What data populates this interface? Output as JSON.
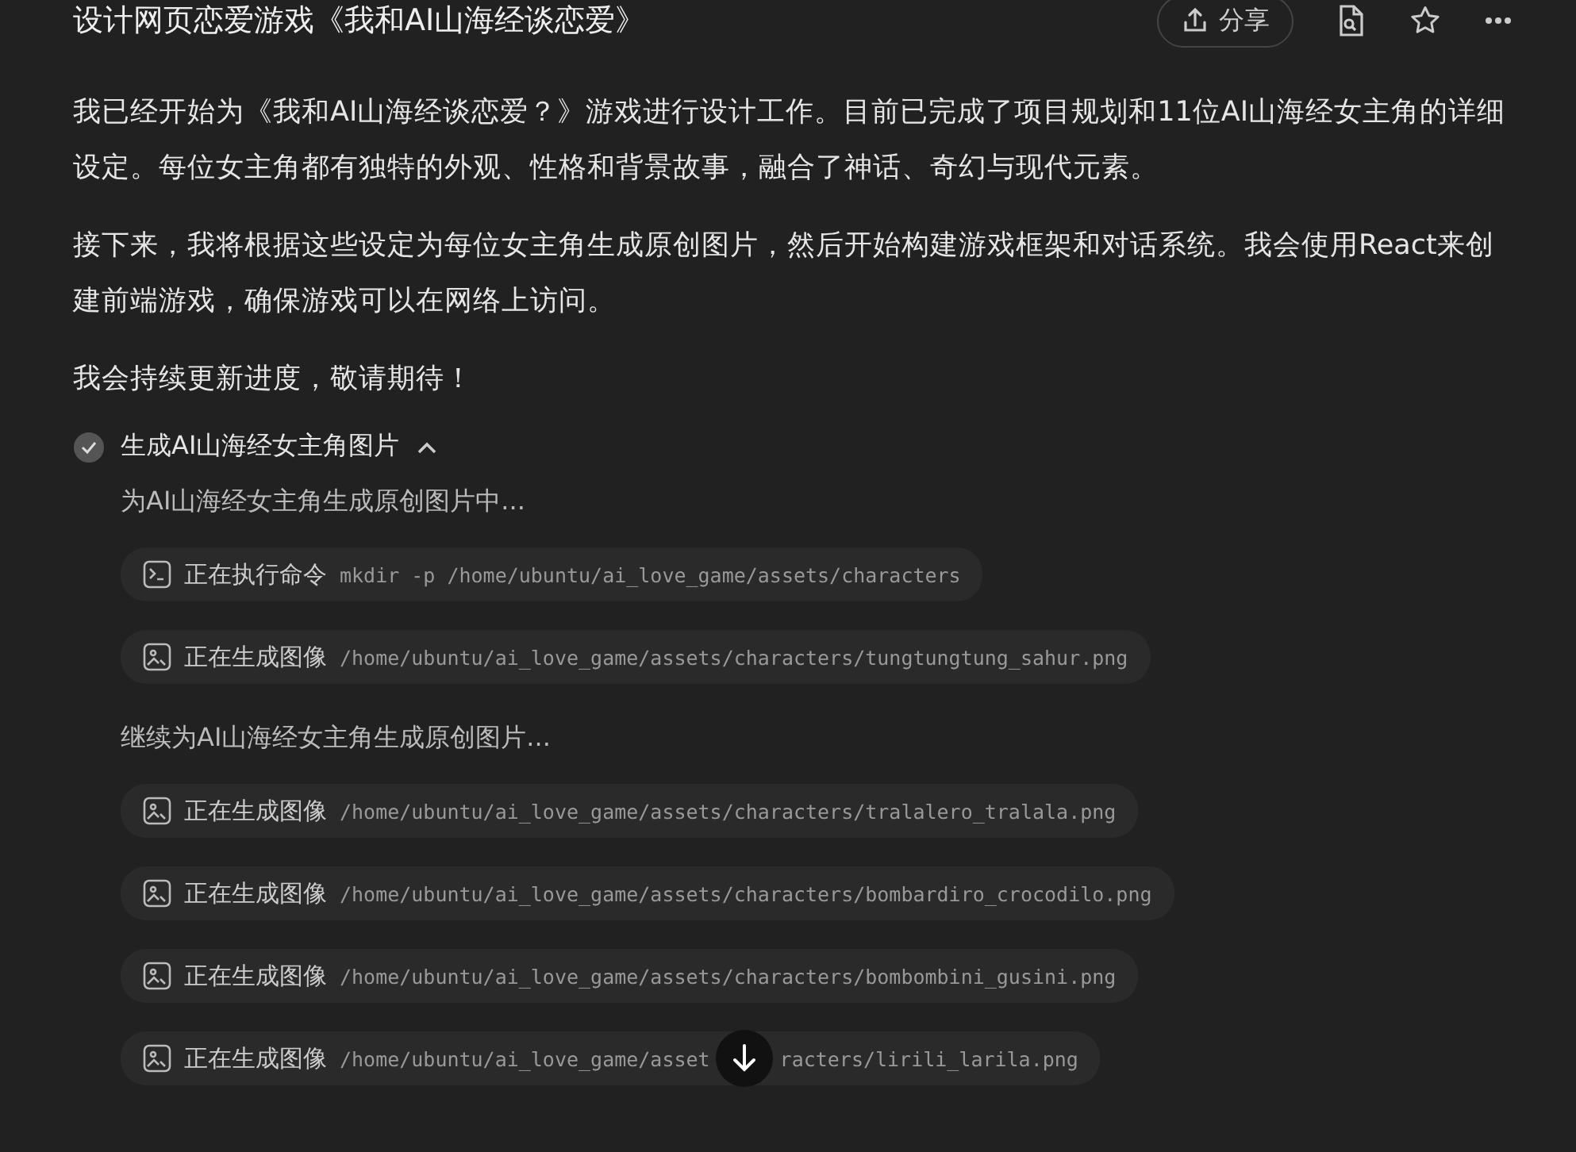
{
  "header": {
    "title": "设计网页恋爱游戏《我和AI山海经谈恋爱》",
    "share": "分享"
  },
  "paragraphs": [
    "我已经开始为《我和AI山海经谈恋爱？》游戏进行设计工作。目前已完成了项目规划和11位AI山海经女主角的详细设定。每位女主角都有独特的外观、性格和背景故事，融合了神话、奇幻与现代元素。",
    "接下来，我将根据这些设定为每位女主角生成原创图片，然后开始构建游戏框架和对话系统。我会使用React来创建前端游戏，确保游戏可以在网络上访问。",
    "我会持续更新进度，敬请期待！"
  ],
  "task": {
    "title": "生成AI山海经女主角图片",
    "done": true,
    "expanded": true,
    "items": [
      {
        "kind": "note",
        "text": "为AI山海经女主角生成原创图片中..."
      },
      {
        "kind": "command",
        "label": "正在执行命令",
        "path": "mkdir -p /home/ubuntu/ai_love_game/assets/characters"
      },
      {
        "kind": "image",
        "label": "正在生成图像",
        "path": "/home/ubuntu/ai_love_game/assets/characters/tungtungtung_sahur.png"
      },
      {
        "kind": "note",
        "text": "继续为AI山海经女主角生成原创图片..."
      },
      {
        "kind": "image",
        "label": "正在生成图像",
        "path": "/home/ubuntu/ai_love_game/assets/characters/tralalero_tralala.png"
      },
      {
        "kind": "image",
        "label": "正在生成图像",
        "path": "/home/ubuntu/ai_love_game/assets/characters/bombardiro_crocodilo.png"
      },
      {
        "kind": "image",
        "label": "正在生成图像",
        "path": "/home/ubuntu/ai_love_game/assets/characters/bombombini_gusini.png"
      },
      {
        "kind": "image",
        "label": "正在生成图像",
        "path": "/home/ubuntu/ai_love_game/asset",
        "path_rest": "racters/lirili_larila.png"
      }
    ]
  }
}
